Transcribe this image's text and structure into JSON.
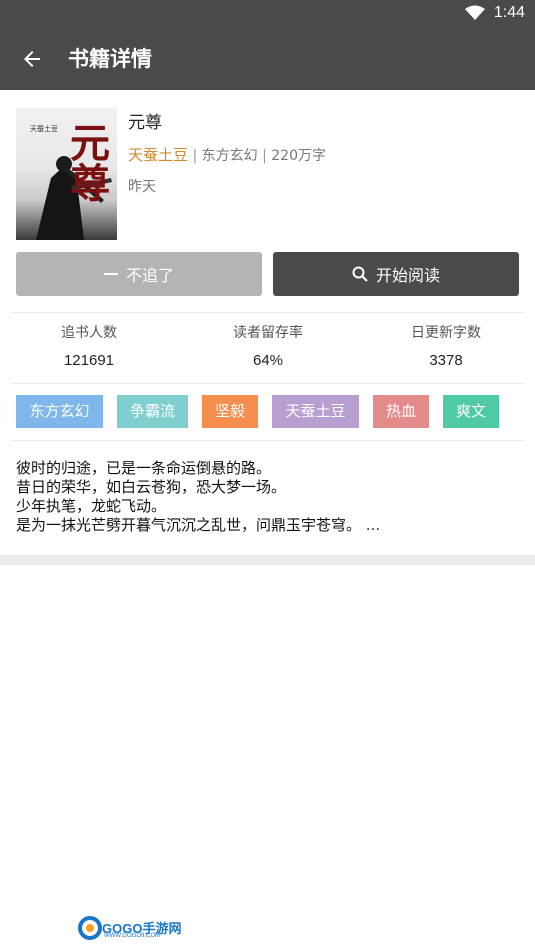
{
  "status_bar": {
    "time": "1:44",
    "wifi_icon": "wifi-icon"
  },
  "app_bar": {
    "title": "书籍详情",
    "back_icon": "arrow-left-icon"
  },
  "book": {
    "cover_text": "元尊",
    "cover_brand": "天蚕土豆",
    "title": "元尊",
    "author": "天蚕土豆",
    "separator": " | ",
    "category": "东方玄幻",
    "word_count": "220万字",
    "updated": "昨天"
  },
  "actions": {
    "unfollow_label": "不追了",
    "read_label": "开始阅读"
  },
  "stats": [
    {
      "label": "追书人数",
      "value": "121691"
    },
    {
      "label": "读者留存率",
      "value": "64%"
    },
    {
      "label": "日更新字数",
      "value": "3378"
    }
  ],
  "tags": [
    {
      "label": "东方玄幻",
      "color": "#7fb7ea"
    },
    {
      "label": "争霸流",
      "color": "#80cfcf"
    },
    {
      "label": "坚毅",
      "color": "#f58e4e"
    },
    {
      "label": "天蚕土豆",
      "color": "#b7a0d1"
    },
    {
      "label": "热血",
      "color": "#e38b8b"
    },
    {
      "label": "爽文",
      "color": "#4fc9a6"
    }
  ],
  "description": {
    "lines": [
      "彼时的归途，已是一条命运倒悬的路。",
      "昔日的荣华，如白云苍狗，恐大梦一场。",
      "少年执笔，龙蛇飞动。",
      "是为一抹光芒劈开暮气沉沉之乱世，问鼎玉宇苍穹。"
    ],
    "ellipsis": "..."
  },
  "watermark": {
    "text": "GOGO手游网",
    "sub": "WWW.GOGO9.COM"
  },
  "colors": {
    "bar": "#4a4a4a",
    "accent_author": "#d38a2e",
    "unfollow_btn": "#b4b4b4",
    "read_btn": "#4a4a4a"
  }
}
